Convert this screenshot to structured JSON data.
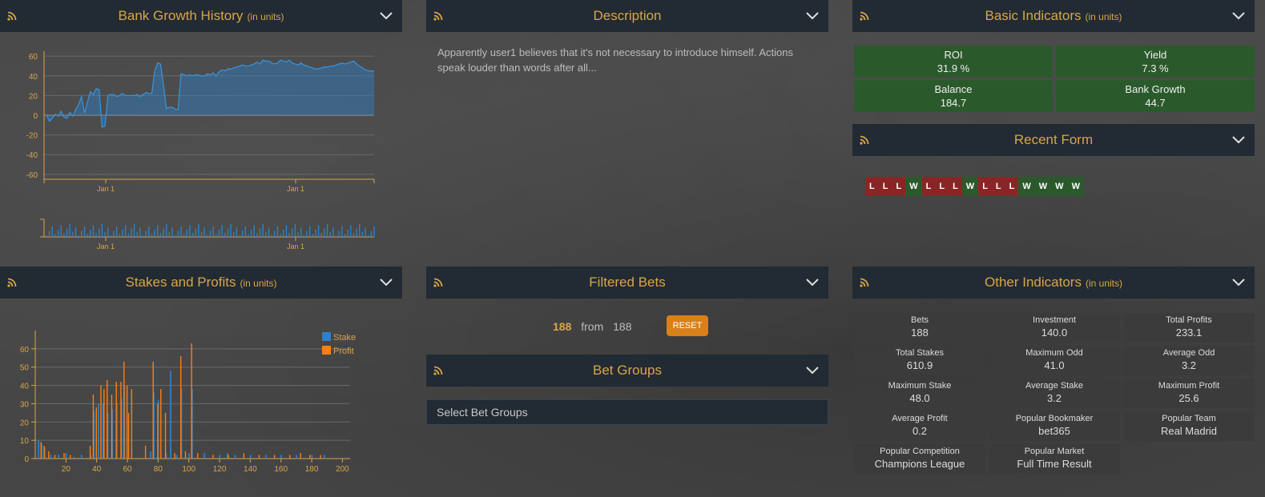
{
  "panels": {
    "bank_growth": {
      "title": "Bank Growth History",
      "units": "(in units)"
    },
    "description": {
      "title": "Description",
      "text": "Apparently user1 believes that it's not necessary to introduce himself. Actions speak louder than words after all..."
    },
    "basic_indicators": {
      "title": "Basic Indicators",
      "units": "(in units)",
      "items": [
        {
          "label": "ROI",
          "value": "31.9 %"
        },
        {
          "label": "Yield",
          "value": "7.3 %"
        },
        {
          "label": "Balance",
          "value": "184.7"
        },
        {
          "label": "Bank Growth",
          "value": "44.7"
        }
      ]
    },
    "recent_form": {
      "title": "Recent Form",
      "results": [
        "L",
        "L",
        "L",
        "W",
        "L",
        "L",
        "L",
        "W",
        "L",
        "L",
        "L",
        "W",
        "W",
        "W",
        "W"
      ]
    },
    "stakes_profits": {
      "title": "Stakes and Profits",
      "units": "(in units)"
    },
    "filtered_bets": {
      "title": "Filtered Bets",
      "count": "188",
      "from_label": "from",
      "total": "188",
      "reset_label": "RESET"
    },
    "bet_groups": {
      "title": "Bet Groups",
      "placeholder": "Select Bet Groups"
    },
    "other_indicators": {
      "title": "Other Indicators",
      "units": "(in units)",
      "items": [
        {
          "label": "Bets",
          "value": "188"
        },
        {
          "label": "Investment",
          "value": "140.0"
        },
        {
          "label": "Total Profits",
          "value": "233.1"
        },
        {
          "label": "Total Stakes",
          "value": "610.9"
        },
        {
          "label": "Maximum Odd",
          "value": "41.0"
        },
        {
          "label": "Average Odd",
          "value": "3.2"
        },
        {
          "label": "Maximum Stake",
          "value": "48.0"
        },
        {
          "label": "Average Stake",
          "value": "3.2"
        },
        {
          "label": "Maximum Profit",
          "value": "25.6"
        },
        {
          "label": "Average Profit",
          "value": "0.2"
        },
        {
          "label": "Popular Bookmaker",
          "value": "bet365"
        },
        {
          "label": "Popular Team",
          "value": "Real Madrid"
        },
        {
          "label": "Popular Competition",
          "value": "Champions League"
        },
        {
          "label": "Popular Market",
          "value": "Full Time Result"
        }
      ]
    }
  },
  "colors": {
    "header_bg": "#222a33",
    "accent": "#d9a54a",
    "win": "#2a5a2b",
    "loss": "#8b2525",
    "stake": "#2f80c8",
    "profit": "#ff7f0e",
    "reset": "#d8801a"
  },
  "chart_data": [
    {
      "type": "area",
      "title": "Bank Growth History",
      "ylim": [
        -65,
        65
      ],
      "yticks": [
        60,
        40,
        20,
        0,
        -20,
        -40,
        -60
      ],
      "xtick_labels": [
        "Jan 1",
        "Jan 1"
      ],
      "series": [
        {
          "values": [
            0,
            -6,
            -3,
            1,
            -1,
            4,
            -2,
            -3,
            3,
            -1,
            6,
            11,
            19,
            2,
            13,
            24,
            21,
            27,
            26,
            -12,
            -11,
            20,
            21,
            21,
            19,
            20,
            22,
            20,
            20,
            20,
            20,
            21,
            19,
            21,
            23,
            22,
            22,
            45,
            53,
            52,
            30,
            7,
            8,
            8,
            6,
            6,
            42,
            41,
            40,
            41,
            40,
            41,
            41,
            40,
            40,
            42,
            41,
            43,
            40,
            44,
            46,
            45,
            47,
            47,
            48,
            49,
            50,
            51,
            50,
            50,
            51,
            52,
            54,
            52,
            56,
            55,
            55,
            53,
            52,
            53,
            56,
            55,
            54,
            56,
            53,
            52,
            51,
            53,
            51,
            50,
            49,
            48,
            47,
            47,
            48,
            49,
            49,
            50,
            50,
            51,
            52,
            53,
            52,
            53,
            54,
            55,
            52,
            50,
            48,
            46,
            45,
            45,
            44.7
          ]
        }
      ]
    },
    {
      "type": "bar",
      "title": "Stakes and Profits",
      "ylim": [
        0,
        70
      ],
      "yticks": [
        60,
        50,
        40,
        30,
        20,
        10,
        0
      ],
      "xticks": [
        20,
        40,
        60,
        80,
        100,
        120,
        140,
        160,
        180,
        200
      ],
      "xlim": [
        0,
        205
      ],
      "series": [
        {
          "name": "Stake",
          "points": [
            [
              2,
              10
            ],
            [
              4,
              8
            ],
            [
              6,
              6
            ],
            [
              10,
              2
            ],
            [
              15,
              2
            ],
            [
              20,
              3
            ],
            [
              25,
              1
            ],
            [
              30,
              2
            ],
            [
              36,
              2
            ],
            [
              38,
              26
            ],
            [
              41,
              30
            ],
            [
              44,
              30
            ],
            [
              47,
              25
            ],
            [
              50,
              27
            ],
            [
              53,
              30
            ],
            [
              56,
              33
            ],
            [
              58,
              40
            ],
            [
              75,
              4
            ],
            [
              77,
              36
            ],
            [
              80,
              32
            ],
            [
              85,
              3
            ],
            [
              88,
              48
            ],
            [
              92,
              2
            ],
            [
              95,
              38
            ],
            [
              100,
              3
            ],
            [
              102,
              38
            ],
            [
              110,
              3
            ],
            [
              120,
              2
            ],
            [
              125,
              3
            ],
            [
              130,
              2
            ],
            [
              140,
              2
            ],
            [
              150,
              2
            ],
            [
              160,
              2
            ],
            [
              170,
              2
            ],
            [
              180,
              2
            ],
            [
              188,
              2
            ]
          ]
        },
        {
          "name": "Profit",
          "points": [
            [
              3,
              9
            ],
            [
              5,
              7
            ],
            [
              8,
              4
            ],
            [
              12,
              2
            ],
            [
              18,
              3
            ],
            [
              22,
              2
            ],
            [
              35,
              7
            ],
            [
              37,
              35
            ],
            [
              39,
              28
            ],
            [
              42,
              40
            ],
            [
              44,
              38
            ],
            [
              46,
              43
            ],
            [
              49,
              35
            ],
            [
              52,
              42
            ],
            [
              55,
              42
            ],
            [
              57,
              53
            ],
            [
              59,
              40
            ],
            [
              60,
              25
            ],
            [
              62,
              38
            ],
            [
              71,
              7
            ],
            [
              76,
              53
            ],
            [
              79,
              30
            ],
            [
              81,
              38
            ],
            [
              84,
              25
            ],
            [
              90,
              3
            ],
            [
              94,
              56
            ],
            [
              97,
              4
            ],
            [
              101,
              63
            ],
            [
              105,
              3
            ],
            [
              115,
              2
            ],
            [
              125,
              2
            ],
            [
              135,
              3
            ],
            [
              145,
              2
            ],
            [
              155,
              2
            ],
            [
              165,
              2
            ],
            [
              172,
              3
            ],
            [
              178,
              2
            ],
            [
              185,
              2
            ]
          ]
        }
      ]
    }
  ]
}
